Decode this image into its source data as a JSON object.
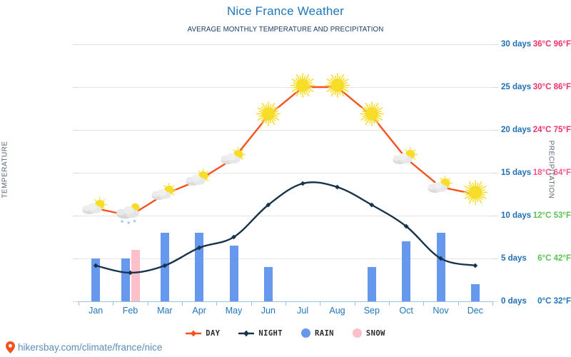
{
  "header": {
    "title": "Nice France Weather",
    "subtitle": "AVERAGE MONTHLY TEMPERATURE AND PRECIPITATION",
    "title_color": "#2176b8",
    "subtitle_color": "#1b3d66"
  },
  "axes": {
    "left_title": "TEMPERATURE",
    "right_title": "PRECIPITATION",
    "left_ticks": [
      {
        "label": "36°C 96°F",
        "value": 36,
        "color": "#f0306a"
      },
      {
        "label": "30°C 86°F",
        "value": 30,
        "color": "#f0306a"
      },
      {
        "label": "24°C 75°F",
        "value": 24,
        "color": "#f0306a"
      },
      {
        "label": "18°C 64°F",
        "value": 18,
        "color": "#f4578c"
      },
      {
        "label": "12°C 53°F",
        "value": 12,
        "color": "#5cc254"
      },
      {
        "label": "6°C 42°F",
        "value": 6,
        "color": "#5cc254"
      },
      {
        "label": "0°C 32°F",
        "value": 0,
        "color": "#2176b8"
      }
    ],
    "right_ticks": [
      {
        "label": "30 days",
        "value": 30
      },
      {
        "label": "25 days",
        "value": 25
      },
      {
        "label": "20 days",
        "value": 20
      },
      {
        "label": "15 days",
        "value": 15
      },
      {
        "label": "10 days",
        "value": 10
      },
      {
        "label": "5 days",
        "value": 5
      },
      {
        "label": "0 days",
        "value": 0
      }
    ]
  },
  "legend": {
    "items": [
      {
        "label": "DAY",
        "type": "line",
        "color": "#f4511e"
      },
      {
        "label": "NIGHT",
        "type": "line",
        "color": "#17344a"
      },
      {
        "label": "RAIN",
        "type": "dot",
        "color": "#6699ee"
      },
      {
        "label": "SNOW",
        "type": "dot",
        "color": "#fcc0cb"
      }
    ]
  },
  "footer": {
    "url": "hikersbay.com/climate/france/nice",
    "icon": "location-pin-icon",
    "pin_color": "#f4511e",
    "text_color": "#5b8db8"
  },
  "chart_data": {
    "type": "line",
    "title": "Nice France Weather",
    "subtitle": "AVERAGE MONTHLY TEMPERATURE AND PRECIPITATION",
    "xlabel": "",
    "ylabel": "TEMPERATURE",
    "y2label": "PRECIPITATION",
    "categories": [
      "Jan",
      "Feb",
      "Mar",
      "Apr",
      "May",
      "Jun",
      "Jul",
      "Aug",
      "Sep",
      "Oct",
      "Nov",
      "Dec"
    ],
    "ylim": [
      0,
      36
    ],
    "y2lim": [
      0,
      30
    ],
    "grid": true,
    "legend_position": "bottom",
    "series": [
      {
        "name": "DAY",
        "type": "line",
        "color": "#f4511e",
        "unit": "°C",
        "values": [
          13,
          12,
          15,
          17,
          20,
          26,
          30,
          30,
          26,
          20,
          16,
          15
        ]
      },
      {
        "name": "NIGHT",
        "type": "line",
        "color": "#17344a",
        "unit": "°C",
        "values": [
          5,
          4,
          5,
          7.5,
          9,
          13.5,
          16.5,
          16,
          13.5,
          10.5,
          6,
          5
        ]
      },
      {
        "name": "RAIN",
        "type": "bar",
        "color": "#6699ee",
        "unit": "days",
        "axis": "right",
        "values": [
          5,
          5,
          8,
          8,
          6.5,
          4,
          0,
          0,
          4,
          7,
          8,
          2
        ]
      },
      {
        "name": "SNOW",
        "type": "bar",
        "color": "#fcc0cb",
        "unit": "days",
        "axis": "right",
        "values": [
          0,
          6,
          0,
          0,
          0,
          0,
          0,
          0,
          0,
          0,
          0,
          0
        ]
      }
    ],
    "weather_icons": [
      "sun-behind-cloud-icon",
      "snow-cloud-icon",
      "sun-behind-cloud-icon",
      "sun-behind-cloud-icon",
      "sun-behind-cloud-icon",
      "sun-icon",
      "sun-icon",
      "sun-icon",
      "sun-icon",
      "sun-behind-cloud-icon",
      "sun-behind-cloud-icon",
      "sun-icon"
    ]
  }
}
